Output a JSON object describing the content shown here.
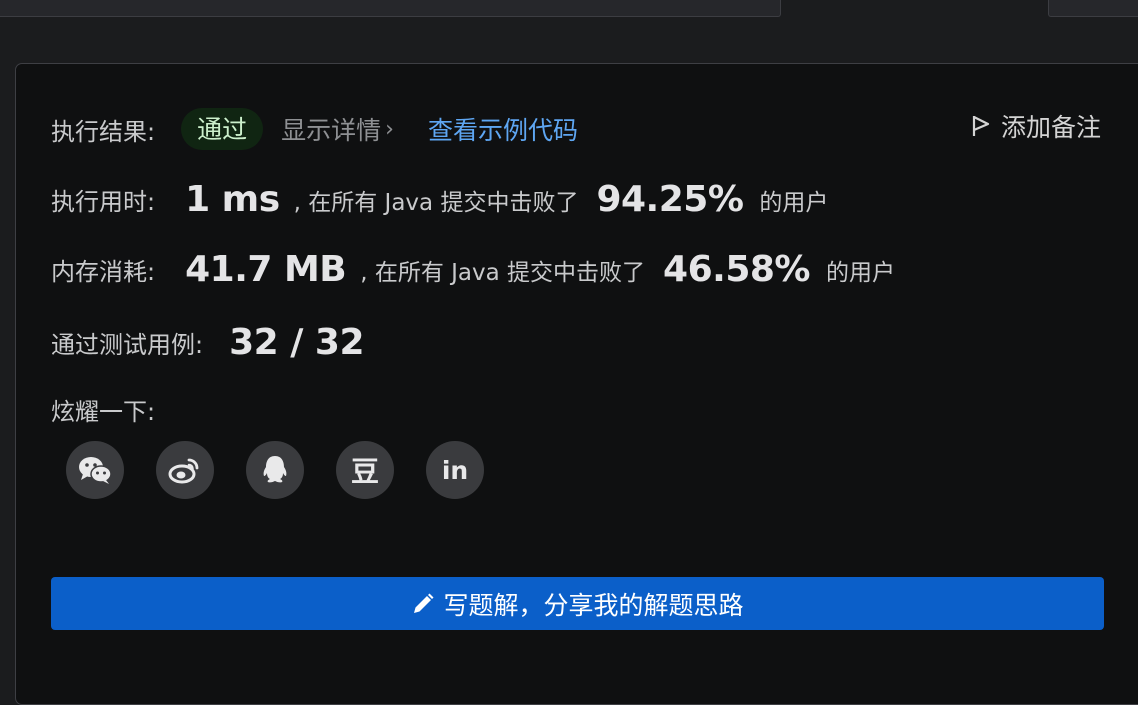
{
  "result": {
    "label": "执行结果:",
    "status": "通过",
    "detail_link": "显示详情",
    "detail_chevron": "›",
    "example_link": "查看示例代码",
    "add_note": "添加备注"
  },
  "runtime": {
    "label": "执行用时:",
    "value": "1 ms",
    "mid_text": ", 在所有 Java 提交中击败了",
    "percent": "94.25%",
    "tail": "的用户"
  },
  "memory": {
    "label": "内存消耗:",
    "value": "41.7 MB",
    "mid_text": ", 在所有 Java 提交中击败了",
    "percent": "46.58%",
    "tail": "的用户"
  },
  "testcases": {
    "label": "通过测试用例:",
    "value": "32 / 32"
  },
  "share": {
    "label": "炫耀一下:",
    "icons": [
      "wechat-icon",
      "weibo-icon",
      "qq-icon",
      "douban-icon",
      "linkedin-icon"
    ],
    "douban_char": "豆",
    "linkedin_text": "in"
  },
  "write_solution": {
    "label": "写题解，分享我的解题思路"
  },
  "colors": {
    "accent_button": "#0b5fc9",
    "pass_text": "#ccf0cc",
    "link": "#5ea6f2"
  }
}
